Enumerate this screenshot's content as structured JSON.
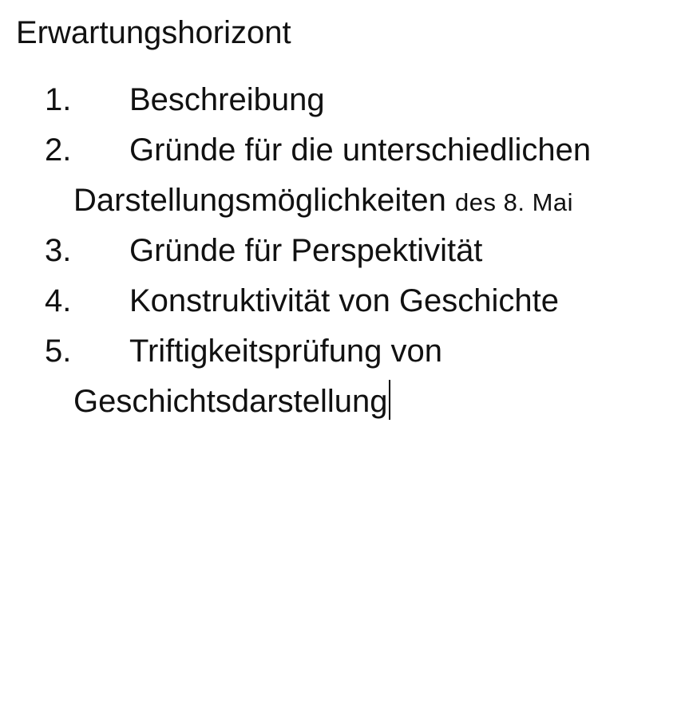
{
  "document": {
    "title": "Erwartungshorizont",
    "items": [
      {
        "number": "1.",
        "text": "Beschreibung"
      },
      {
        "number": "2.",
        "text": "Gründe für die unterschiedlichen",
        "continuation": "Darstellungsmöglichkeiten",
        "continuation_suffix": "des 8. Mai"
      },
      {
        "number": "3.",
        "text": "Gründe für Perspektivität"
      },
      {
        "number": "4.",
        "text": "Konstruktivität von Geschichte"
      },
      {
        "number": "5.",
        "text": "Triftigkeitsprüfung von",
        "continuation": "Geschichtsdarstellung"
      }
    ]
  }
}
